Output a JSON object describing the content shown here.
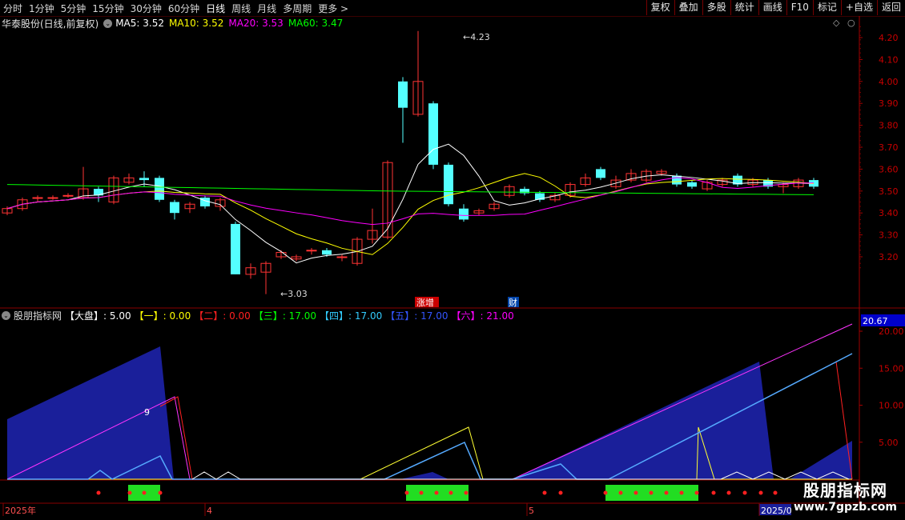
{
  "toolbar": {
    "tabs": [
      "分时",
      "1分钟",
      "5分钟",
      "15分钟",
      "30分钟",
      "60分钟",
      "日线",
      "周线",
      "月线",
      "多周期",
      "更多 >"
    ],
    "active_tab": "日线",
    "buttons": [
      "复权",
      "叠加",
      "多股",
      "统计",
      "画线",
      "F10",
      "标记",
      "+自选",
      "返回"
    ]
  },
  "main_chart": {
    "stock_title": "华泰股份(日线,前复权)",
    "ma": [
      {
        "label": "MA5: 3.52",
        "color": "#ffffff"
      },
      {
        "label": "MA10: 3.52",
        "color": "#ffff00"
      },
      {
        "label": "MA20: 3.53",
        "color": "#ff00ff"
      },
      {
        "label": "MA60: 3.47",
        "color": "#00ff00"
      }
    ],
    "price_axis": [
      "4.20",
      "4.10",
      "4.00",
      "3.90",
      "3.80",
      "3.70",
      "3.60",
      "3.50",
      "3.40",
      "3.30",
      "3.20"
    ],
    "high_label": "4.23",
    "low_label": "3.03",
    "event_labels": [
      {
        "text": "涨增",
        "color": "#ffffff",
        "bg": "#cc0000"
      },
      {
        "text": "财",
        "color": "#ffffff",
        "bg": "#0044aa"
      }
    ]
  },
  "indicator": {
    "name": "股朋指标网",
    "items": [
      {
        "label": "【大盘】",
        "value": ": 5.00",
        "color": "#ffffff"
      },
      {
        "label": "【一】",
        "value": ": 0.00",
        "color": "#ffff00"
      },
      {
        "label": "【二】",
        "value": ": 0.00",
        "color": "#ff2020"
      },
      {
        "label": "【三】",
        "value": ": 17.00",
        "color": "#00ff00"
      },
      {
        "label": "【四】",
        "value": ": 17.00",
        "color": "#33ccff"
      },
      {
        "label": "【五】",
        "value": ": 17.00",
        "color": "#3355ff"
      },
      {
        "label": "【六】",
        "value": ": 21.00",
        "color": "#ff00ff"
      }
    ],
    "axis": [
      "20.00",
      "15.00",
      "10.00",
      "5.00"
    ],
    "highlight_value": "20.67",
    "peak_label": "9"
  },
  "date_axis": {
    "labels": [
      "2025年",
      "4",
      "5",
      "2025/0"
    ]
  },
  "watermark": {
    "line1": "股朋指标网",
    "line2": "www.7gpzb.com"
  },
  "colors": {
    "up": "#ff3333",
    "down": "#54ffff",
    "axis": "#a00000"
  }
}
